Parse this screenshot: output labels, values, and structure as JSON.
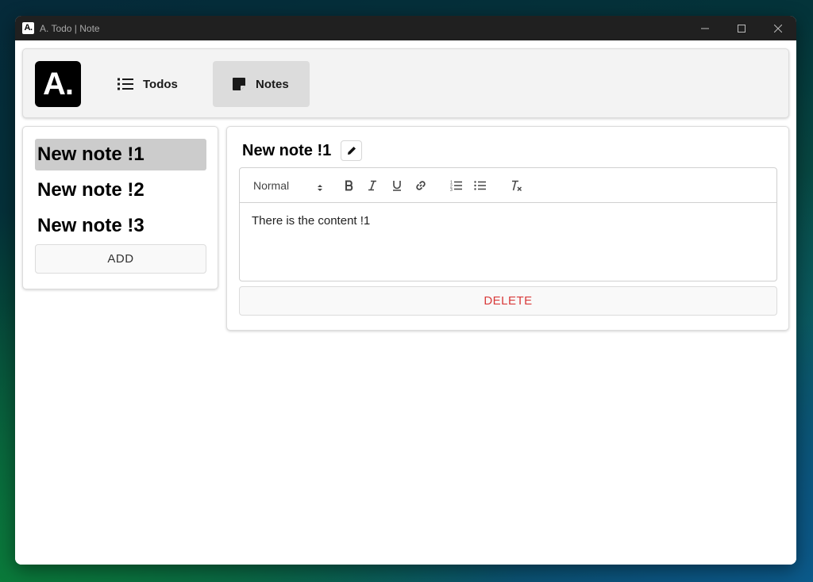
{
  "window": {
    "logo_text": "A.",
    "title": "A. Todo | Note"
  },
  "navbar": {
    "logo_text": "A.",
    "items": [
      {
        "label": "Todos",
        "icon": "list-icon",
        "active": false
      },
      {
        "label": "Notes",
        "icon": "sticky-note-icon",
        "active": true
      }
    ]
  },
  "notes_list": {
    "items": [
      {
        "label": "New note !1",
        "active": true
      },
      {
        "label": "New note !2",
        "active": false
      },
      {
        "label": "New note !3",
        "active": false
      }
    ],
    "add_label": "ADD"
  },
  "editor": {
    "title": "New note !1",
    "format_select": "Normal",
    "toolbar_icons": [
      "bold-icon",
      "italic-icon",
      "underline-icon",
      "link-icon",
      "ordered-list-icon",
      "bullet-list-icon",
      "clear-format-icon"
    ],
    "content": "There is the content !1",
    "delete_label": "DELETE"
  },
  "colors": {
    "active_nav": "#dcdcdc",
    "active_note": "#cccccc",
    "delete": "#d93a3a"
  }
}
